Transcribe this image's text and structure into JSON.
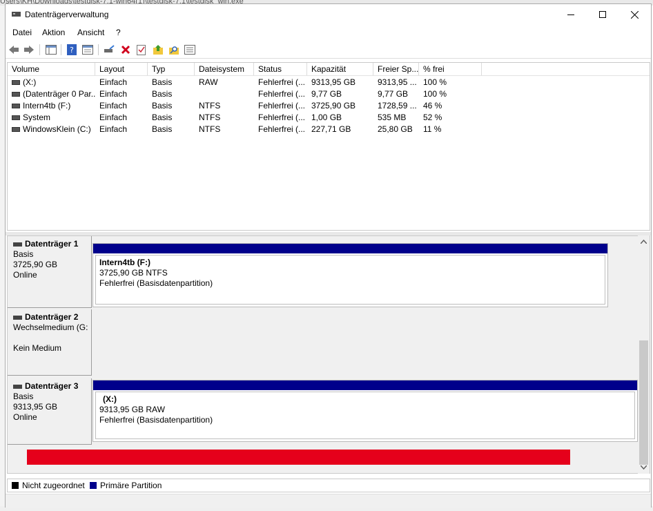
{
  "background": {
    "path_text": "Users\\KH\\Downloads\\testdisk-7.1-win64(1)\\testdisk-7.1\\testdisk_win.exe"
  },
  "window": {
    "title": "Datenträgerverwaltung"
  },
  "menu": {
    "datei": "Datei",
    "aktion": "Aktion",
    "ansicht": "Ansicht",
    "hilfe": "?"
  },
  "volumes": {
    "columns": [
      "Volume",
      "Layout",
      "Typ",
      "Dateisystem",
      "Status",
      "Kapazität",
      "Freier Sp...",
      "% frei"
    ],
    "rows": [
      {
        "volume": "(X:)",
        "layout": "Einfach",
        "typ": "Basis",
        "dateisystem": "RAW",
        "status": "Fehlerfrei (...",
        "kapazitaet": "9313,95 GB",
        "frei": "9313,95 ...",
        "prozent": "100 %"
      },
      {
        "volume": "(Datenträger 0 Par...",
        "layout": "Einfach",
        "typ": "Basis",
        "dateisystem": "",
        "status": "Fehlerfrei (...",
        "kapazitaet": "9,77 GB",
        "frei": "9,77 GB",
        "prozent": "100 %"
      },
      {
        "volume": "Intern4tb (F:)",
        "layout": "Einfach",
        "typ": "Basis",
        "dateisystem": "NTFS",
        "status": "Fehlerfrei (...",
        "kapazitaet": "3725,90 GB",
        "frei": "1728,59 ...",
        "prozent": "46 %"
      },
      {
        "volume": "System",
        "layout": "Einfach",
        "typ": "Basis",
        "dateisystem": "NTFS",
        "status": "Fehlerfrei (...",
        "kapazitaet": "1,00 GB",
        "frei": "535 MB",
        "prozent": "52 %"
      },
      {
        "volume": "WindowsKlein (C:)",
        "layout": "Einfach",
        "typ": "Basis",
        "dateisystem": "NTFS",
        "status": "Fehlerfrei (...",
        "kapazitaet": "227,71 GB",
        "frei": "25,80 GB",
        "prozent": "11 %"
      }
    ]
  },
  "disks": [
    {
      "name": "Datenträger 1",
      "type": "Basis",
      "size": "3725,90 GB",
      "state": "Online",
      "partition": {
        "name": "Intern4tb  (F:)",
        "detail": "3725,90 GB NTFS",
        "status": "Fehlerfrei (Basisdatenpartition)"
      }
    },
    {
      "name": "Datenträger 2",
      "type": "Wechselmedium (G:",
      "state": "Kein Medium"
    },
    {
      "name": "Datenträger 3",
      "type": "Basis",
      "size": "9313,95 GB",
      "state": "Online",
      "partition": {
        "name": "(X:)",
        "detail": "9313,95 GB RAW",
        "status": "Fehlerfrei (Basisdatenpartition)"
      }
    }
  ],
  "legend": {
    "unallocated": "Nicht zugeordnet",
    "primary": "Primäre Partition"
  },
  "colors": {
    "primary_partition": "#00008b",
    "unallocated": "#000000",
    "redaction": "#e5001b"
  }
}
